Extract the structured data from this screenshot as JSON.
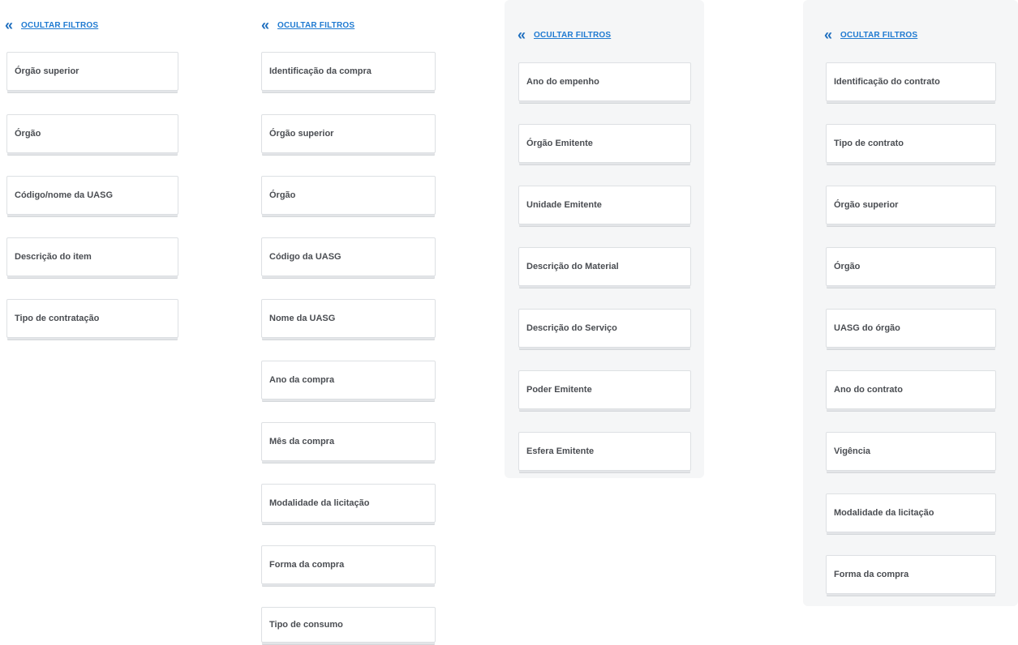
{
  "panels": [
    {
      "toggle_label": "OCULTAR FILTROS",
      "filters": [
        "Órgão superior",
        "Órgão",
        "Código/nome da UASG",
        "Descrição do item",
        "Tipo de contratação"
      ]
    },
    {
      "toggle_label": "OCULTAR FILTROS",
      "filters": [
        "Identificação da compra",
        "Órgão superior",
        "Órgão",
        "Código da UASG",
        "Nome da UASG",
        "Ano da compra",
        "Mês da compra",
        "Modalidade da licitação",
        "Forma da compra",
        "Tipo de consumo"
      ]
    },
    {
      "toggle_label": "OCULTAR FILTROS",
      "filters": [
        "Ano do empenho",
        "Órgão Emitente",
        "Unidade Emitente",
        "Descrição do Material",
        "Descrição do Serviço",
        "Poder Emitente",
        "Esfera Emitente"
      ]
    },
    {
      "toggle_label": "OCULTAR FILTROS",
      "filters": [
        "Identificação do contrato",
        "Tipo de contrato",
        "Órgão superior",
        "Órgão",
        "UASG do órgão",
        "Ano do contrato",
        "Vigência",
        "Modalidade da licitação",
        "Forma da compra"
      ]
    }
  ],
  "icons": {
    "collapse": "double-chevron-left-icon"
  },
  "colors": {
    "link": "#1f7ad1",
    "panel_bg": "#f5f6f7",
    "label": "#4a4d52"
  }
}
